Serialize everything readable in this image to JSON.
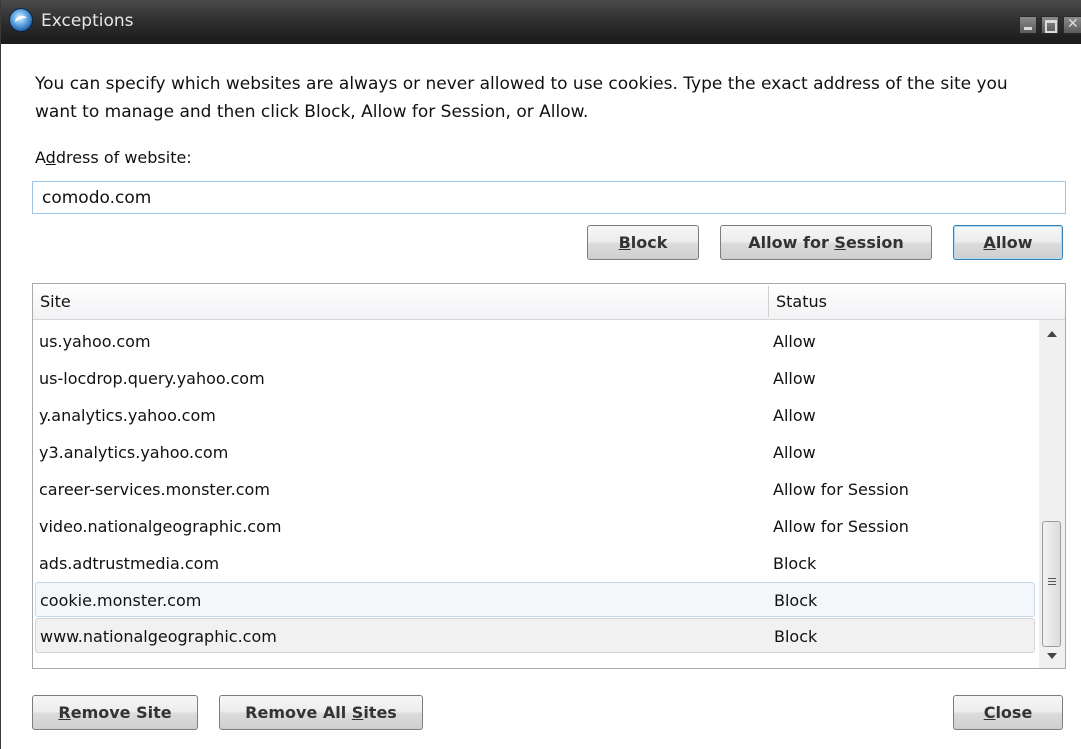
{
  "window": {
    "title": "Exceptions"
  },
  "description": "You can specify which websites are always or never allowed to use cookies. Type the exact address of the site you want to manage and then click Block, Allow for Session, or Allow.",
  "address": {
    "label_prefix": "A",
    "label_accel": "d",
    "label_suffix": "dress of website:",
    "value": "comodo.com"
  },
  "actions": {
    "block": {
      "accel": "B",
      "rest": "lock"
    },
    "allow_session": {
      "prefix": "Allow for ",
      "accel": "S",
      "rest": "ession"
    },
    "allow": {
      "accel": "A",
      "rest": "llow"
    }
  },
  "list": {
    "columns": {
      "site": "Site",
      "status": "Status"
    },
    "rows": [
      {
        "site": "us.yahoo.com",
        "status": "Allow"
      },
      {
        "site": "us-locdrop.query.yahoo.com",
        "status": "Allow"
      },
      {
        "site": "y.analytics.yahoo.com",
        "status": "Allow"
      },
      {
        "site": "y3.analytics.yahoo.com",
        "status": "Allow"
      },
      {
        "site": "career-services.monster.com",
        "status": "Allow for Session"
      },
      {
        "site": "video.nationalgeographic.com",
        "status": "Allow for Session"
      },
      {
        "site": "ads.adtrustmedia.com",
        "status": "Block"
      },
      {
        "site": "cookie.monster.com",
        "status": "Block"
      },
      {
        "site": "www.nationalgeographic.com",
        "status": "Block"
      }
    ]
  },
  "footer": {
    "remove_site": {
      "accel": "R",
      "rest": "emove Site"
    },
    "remove_all": {
      "prefix": "Remove All ",
      "accel": "S",
      "rest": "ites"
    },
    "close": {
      "accel": "C",
      "rest": "lose"
    }
  }
}
